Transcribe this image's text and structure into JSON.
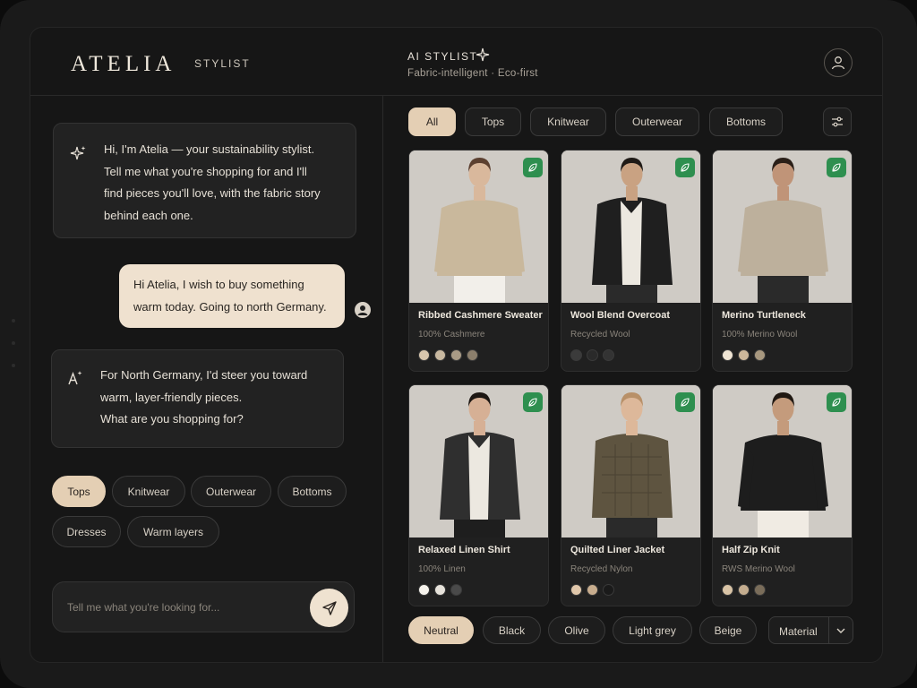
{
  "brand": {
    "logo": "ATELIA",
    "sub": "STYLIST"
  },
  "header": {
    "title": "AI STYLIST",
    "subtitle": "Fabric-intelligent · Eco-first"
  },
  "chat": {
    "messages": [
      {
        "role": "assistant",
        "text": "Hi, I'm Atelia — your sustainability stylist.\nTell me what you're shopping for and I'll\nfind pieces you'll love, with the fabric story\nbehind each one."
      },
      {
        "role": "user",
        "text": "Hi Atelia, I wish to buy something\nwarm today. Going to north Germany."
      },
      {
        "role": "assistant",
        "text": "For North Germany, I'd steer you toward\nwarm, layer-friendly pieces.\nWhat are you shopping for?"
      }
    ],
    "quick_replies": [
      "Tops",
      "Knitwear",
      "Outerwear",
      "Bottoms",
      "Dresses",
      "Warm layers"
    ],
    "quick_reply_active": "Tops",
    "input_placeholder": "Tell me what you're looking for..."
  },
  "category_tabs": [
    "All",
    "Tops",
    "Knitwear",
    "Outerwear",
    "Bottoms"
  ],
  "category_active": "All",
  "products": [
    {
      "name": "Ribbed Cashmere Sweater",
      "material": "100% Cashmere",
      "swatches": [
        "#d8c6ad",
        "#c8b8a0",
        "#a99b86",
        "#8c7f6c"
      ],
      "garment": "#c9b89c",
      "garment_style": "sweater",
      "bottom": "#f2efea",
      "skin": "#d9b89c",
      "hair": "#5c4030"
    },
    {
      "name": "Wool Blend Overcoat",
      "material": "Recycled Wool",
      "swatches": [
        "#3b3b3b",
        "#2a2a2a",
        "#333333"
      ],
      "garment": "#1f1f1f",
      "garment_style": "coat",
      "bottom": "#2a2a2a",
      "skin": "#c9a282",
      "hair": "#1f1a16"
    },
    {
      "name": "Merino Turtleneck",
      "material": "100% Merino Wool",
      "swatches": [
        "#efe4d3",
        "#cdb89b",
        "#a8987f"
      ],
      "garment": "#bdb09c",
      "garment_style": "sweater",
      "bottom": "#2a2a2a",
      "skin": "#c09478",
      "hair": "#2a1f18"
    },
    {
      "name": "Relaxed Linen Shirt",
      "material": "100% Linen",
      "swatches": [
        "#f5f2ec",
        "#e6e2da",
        "#4a4a4a"
      ],
      "garment": "#2f2f2f",
      "garment_style": "coat",
      "bottom": "#1e1e1e",
      "skin": "#d6b095",
      "hair": "#1c1612"
    },
    {
      "name": "Quilted Liner Jacket",
      "material": "Recycled Nylon",
      "swatches": [
        "#e0c7aa",
        "#c8ad8e",
        "#1a1a1a"
      ],
      "garment": "#5e5440",
      "garment_style": "jacket",
      "bottom": "#2a2a2a",
      "skin": "#ddb89a",
      "hair": "#b89068"
    },
    {
      "name": "Half Zip Knit",
      "material": "RWS Merino Wool",
      "swatches": [
        "#d9c4a6",
        "#c4ad8f",
        "#7a6d5a"
      ],
      "garment": "#1d1d1d",
      "garment_style": "sweater",
      "bottom": "#f0ebe3",
      "skin": "#c49b7c",
      "hair": "#201812"
    }
  ],
  "color_filters": [
    "Neutral",
    "Black",
    "Olive",
    "Light grey",
    "Beige"
  ],
  "color_active": "Neutral",
  "material_select": "Material"
}
